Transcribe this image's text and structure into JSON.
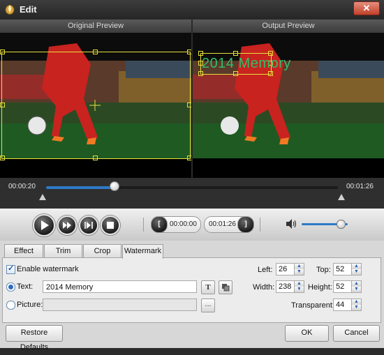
{
  "window": {
    "title": "Edit",
    "close_label": "✕"
  },
  "panes": {
    "original": "Original Preview",
    "output": "Output Preview"
  },
  "watermark_overlay": "2014 Memory",
  "timeline": {
    "start": "00:00:20",
    "end": "00:01:26",
    "progress": 0.235
  },
  "playback": {
    "play_icon": "play-icon",
    "ff_icon": "fast-forward-icon",
    "frame_icon": "next-frame-icon",
    "stop_icon": "stop-icon",
    "start_time": "00:00:00",
    "end_time": "00:01:26",
    "volume": 0.85
  },
  "tabs": [
    "Effect",
    "Trim",
    "Crop",
    "Watermark"
  ],
  "active_tab": "Watermark",
  "watermark": {
    "enable_label": "Enable watermark",
    "enabled": true,
    "text_label": "Text:",
    "text_value": "2014 Memory",
    "picture_label": "Picture:",
    "picture_value": "",
    "browse_label": "...",
    "font_label": "T"
  },
  "position": {
    "left_label": "Left:",
    "left": "26",
    "top_label": "Top:",
    "top": "52",
    "width_label": "Width:",
    "width": "238",
    "height_label": "Height:",
    "height": "52",
    "transparent_label": "Transparent:",
    "transparent": "44"
  },
  "buttons": {
    "restore": "Restore Defaults",
    "ok": "OK",
    "cancel": "Cancel"
  },
  "colors": {
    "accent": "#2e7ac7",
    "selection": "#e8e03a",
    "watermark": "#2fbf6a",
    "close": "#c2402b"
  }
}
